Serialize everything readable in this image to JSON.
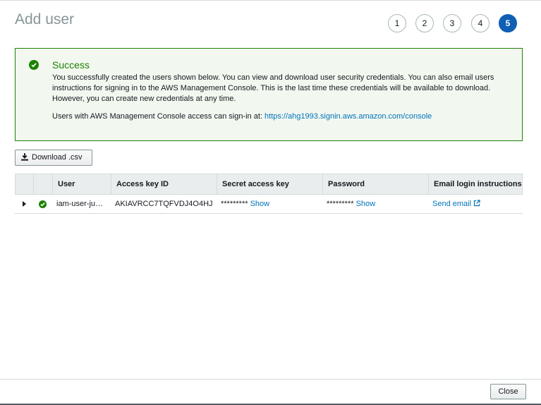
{
  "page": {
    "title": "Add user"
  },
  "steps": [
    {
      "label": "1"
    },
    {
      "label": "2"
    },
    {
      "label": "3"
    },
    {
      "label": "4"
    },
    {
      "label": "5",
      "active": true
    }
  ],
  "success": {
    "title": "Success",
    "message": "You successfully created the users shown below. You can view and download user security credentials. You can also email users instructions for signing in to the AWS Management Console. This is the last time these credentials will be available to download. However, you can create new credentials at any time.",
    "signin_prefix": "Users with AWS Management Console access can sign-in at: ",
    "signin_url": "https://ahg1993.signin.aws.amazon.com/console",
    "icon": "check-circle-icon"
  },
  "toolbar": {
    "download_label": "Download .csv",
    "download_icon": "download-icon"
  },
  "table": {
    "columns": [
      "User",
      "Access key ID",
      "Secret access key",
      "Password",
      "Email login instructions"
    ],
    "rows": [
      {
        "user": "iam-user-ju…",
        "access_key_id": "AKIAVRCC7TQFVDJ4O4HJ",
        "secret_mask": "*********",
        "secret_show": "Show",
        "password_mask": "*********",
        "password_show": "Show",
        "email_link": "Send email"
      }
    ]
  },
  "footer": {
    "close_label": "Close"
  },
  "colors": {
    "success": "#1d8102",
    "link": "#0073bb",
    "step_active": "#0f5fb4"
  }
}
